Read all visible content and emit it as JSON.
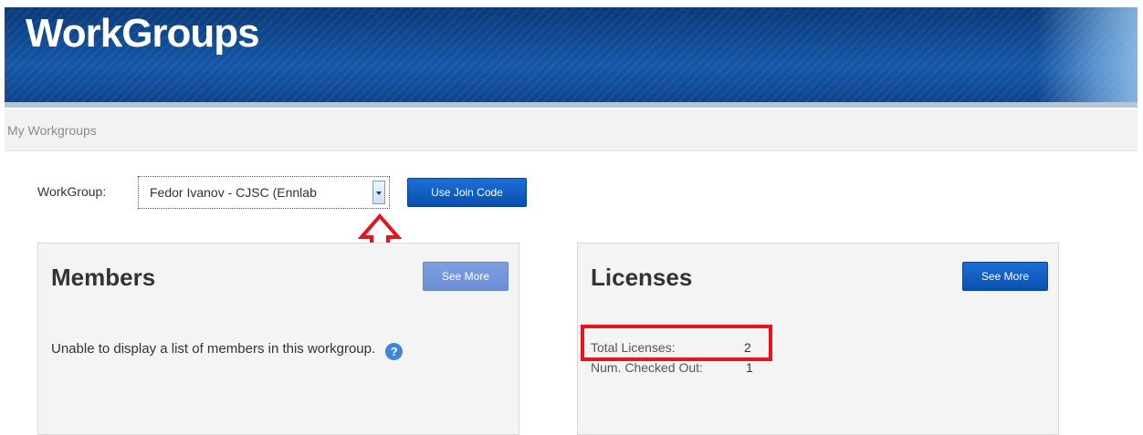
{
  "header": {
    "title": "WorkGroups"
  },
  "breadcrumb": {
    "text": "My Workgroups"
  },
  "workgroup": {
    "label": "WorkGroup:",
    "selected": "Fedor Ivanov - CJSC (Ennlab",
    "join_button": "Use Join Code"
  },
  "members": {
    "title": "Members",
    "see_more": "See More",
    "message": "Unable to display a list of members in this workgroup.",
    "help_icon": "question-icon"
  },
  "licenses": {
    "title": "Licenses",
    "see_more": "See More",
    "rows": [
      {
        "label": "Total Licenses:",
        "value": "2"
      },
      {
        "label": "Num. Checked Out:",
        "value": "1"
      }
    ]
  },
  "colors": {
    "banner": "#1557a8",
    "button": "#0a4fb0",
    "annotation": "#e8141b"
  }
}
